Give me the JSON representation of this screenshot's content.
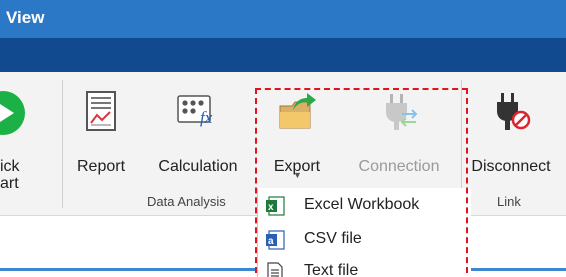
{
  "window": {
    "title": "View"
  },
  "ribbon": {
    "start_button": {
      "line1": "ick",
      "line2": "art"
    },
    "buttons": {
      "report": "Report",
      "calculation": "Calculation",
      "export": "Export",
      "connection": "Connection",
      "disconnect": "Disconnect"
    },
    "groups": {
      "data_analysis": "Data Analysis",
      "link": "Link"
    }
  },
  "export_menu": {
    "items": [
      {
        "label": "Excel Workbook",
        "icon": "excel-icon"
      },
      {
        "label": "CSV file",
        "icon": "csv-icon"
      },
      {
        "label": "Text file",
        "icon": "text-file-icon"
      }
    ]
  },
  "colors": {
    "titlebar": "#2b78c6",
    "tabband": "#114a8f",
    "ribbon": "#f3f3f3",
    "highlight": "#e0141c",
    "start_green": "#1bb146"
  }
}
